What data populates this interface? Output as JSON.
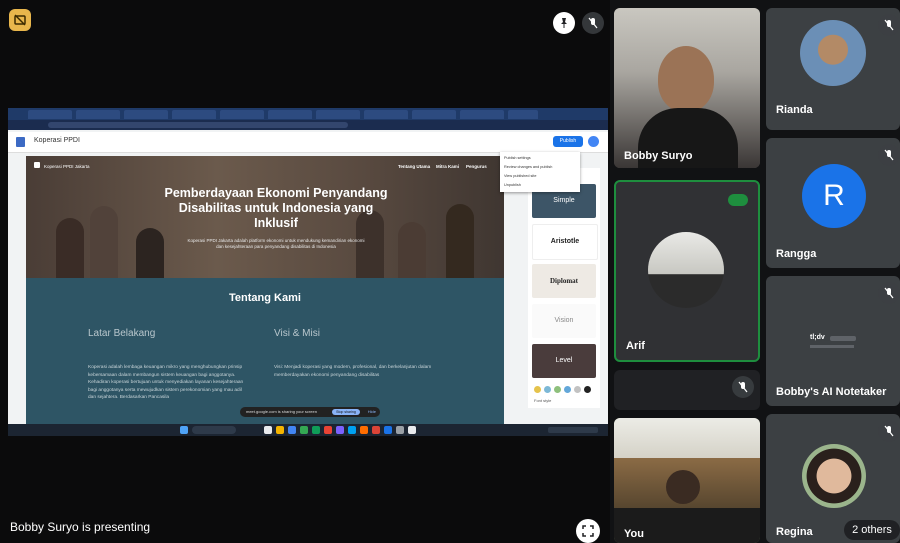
{
  "presentation": {
    "presenter_label": "Bobby Suryo is presenting",
    "shared_screen": {
      "app_title": "Koperasi PPDI",
      "publish_label": "Publish",
      "site_logo_text": "Koperasi PPDI Jakarta",
      "nav_items": [
        "Tentang Utama",
        "Mitra Kami",
        "Pengurus"
      ],
      "hero_title": "Pemberdayaan Ekonomi Penyandang Disabilitas untuk Indonesia yang Inklusif",
      "hero_subtitle": "Koperasi PPDI Jakarta adalah platform ekonomi untuk mendukung kemandirian ekonomi dan kesejahteraan para penyandang disabilitas di Indonesia",
      "section_title": "Tentang Kami",
      "col_left_title": "Latar Belakang",
      "col_left_text": "Koperasi adalah lembaga keuangan mikro yang menghubungkan prinsip kebersamaan dalam membangun sistem keuangan bagi anggotanya. Kehadiran koperasi bertujuan untuk menyediakan layanan kesejahteraan bagi anggotanya serta mewujudkan sistem perekonomian yang mau adil dan sejahtera. Berdasarkan Pancasila",
      "col_right_title": "Visi & Misi",
      "col_right_text": "Visi: Menjadi koperasi yang modern, profesional, dan berkelanjutan dalam memberdayakan ekonomi penyandang disabilitas",
      "themes": [
        "Simple",
        "Aristotle",
        "Diplomat",
        "Vision",
        "Level"
      ],
      "theme_colors": [
        "#e5c34c",
        "#7db8d6",
        "#8ec07c",
        "#63a7d9",
        "#c2c2c2",
        "#222222"
      ],
      "font_style_label": "Font style",
      "dropdown_items": [
        "Publish settings",
        "Review changes and publish",
        "View published site",
        "Unpublish"
      ],
      "toast_text": "meet.google.com is sharing your screen",
      "toast_stop": "Stop sharing",
      "toast_hide": "Hide"
    }
  },
  "participants": [
    {
      "name": "Bobby Suryo",
      "muted": false,
      "type": "video"
    },
    {
      "name": "Arif",
      "muted": false,
      "type": "avatar-photo",
      "speaking": true
    },
    {
      "name": "",
      "muted": true,
      "type": "blank"
    },
    {
      "name": "You",
      "muted": false,
      "type": "video"
    },
    {
      "name": "Rianda",
      "muted": true,
      "type": "avatar-photo"
    },
    {
      "name": "Rangga",
      "initial": "R",
      "muted": true,
      "type": "initial",
      "color": "#1a73e8"
    },
    {
      "name": "Bobby's AI Notetaker",
      "muted": true,
      "type": "logo",
      "logo_text": "tl;dv"
    },
    {
      "name": "Regina",
      "muted": true,
      "type": "avatar-photo"
    }
  ],
  "others_label": "2 others"
}
